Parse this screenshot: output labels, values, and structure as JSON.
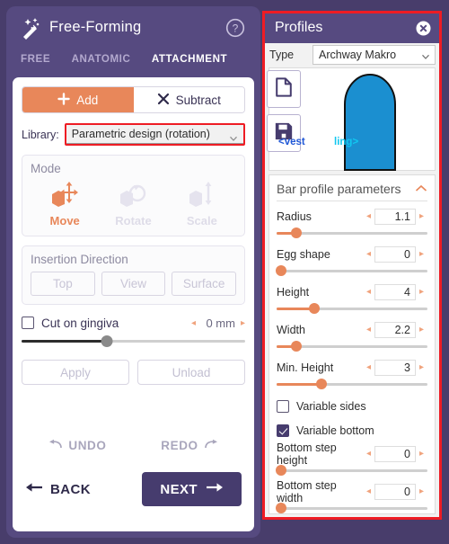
{
  "left_panel": {
    "title": "Free-Forming",
    "wand_icon": "magic-wand-icon",
    "help_icon": "help-circle-icon",
    "tabs": [
      {
        "label": "FREE",
        "active": false
      },
      {
        "label": "ANATOMIC",
        "active": false
      },
      {
        "label": "ATTACHMENT",
        "active": true
      }
    ],
    "segmented": {
      "add_label": "Add",
      "add_icon": "plus-icon",
      "subtract_label": "Subtract",
      "subtract_icon": "x-icon",
      "active": "Add",
      "active_color": "#e8875a"
    },
    "library": {
      "label": "Library:",
      "value": "Parametric design (rotation)",
      "caret_icon": "chevron-down-icon",
      "highlight_color": "#ee1c24"
    },
    "mode": {
      "title": "Mode",
      "items": [
        {
          "label": "Move",
          "icon": "move-tool-icon",
          "state": "active"
        },
        {
          "label": "Rotate",
          "icon": "rotate-tool-icon",
          "state": "disabled"
        },
        {
          "label": "Scale",
          "icon": "scale-tool-icon",
          "state": "disabled"
        }
      ]
    },
    "insertion_direction": {
      "title": "Insertion Direction",
      "buttons": [
        "Top",
        "View",
        "Surface"
      ]
    },
    "cut_on_gingiva": {
      "label": "Cut on gingiva",
      "checked": false,
      "value": "0 mm",
      "slider_percent": 38,
      "left_arrow": "◂",
      "right_arrow": "▸"
    },
    "actions": {
      "apply_label": "Apply",
      "unload_label": "Unload"
    },
    "history": {
      "undo_label": "UNDO",
      "redo_label": "REDO",
      "undo_icon": "undo-arrow-icon",
      "redo_icon": "redo-arrow-icon"
    },
    "nav": {
      "back_label": "BACK",
      "next_label": "NEXT",
      "back_icon": "arrow-left-icon",
      "next_icon": "arrow-right-icon",
      "next_color": "#463c6e"
    }
  },
  "right_panel": {
    "title": "Profiles",
    "close_icon": "close-circle-icon",
    "highlight_color": "#ee1c24",
    "type": {
      "label": "Type",
      "value": "Archway Makro",
      "caret_icon": "chevron-down-icon"
    },
    "tool_buttons": [
      {
        "icon": "new-document-icon",
        "name": "new-profile-button"
      },
      {
        "icon": "floppy-save-icon",
        "name": "save-profile-button"
      }
    ],
    "preview": {
      "shape_color": "#1b8fd0",
      "shape_stroke": "#111111",
      "label_left": "<vest",
      "label_left_color": "#1f57d6",
      "label_right": "ling>",
      "label_right_color": "#11c7f0"
    },
    "params": {
      "title": "Bar profile parameters",
      "collapse_icon": "chevron-up-icon",
      "left_arrow": "◂",
      "right_arrow": "▸",
      "items": [
        {
          "label": "Radius",
          "value": "1.1",
          "percent": 13
        },
        {
          "label": "Egg shape",
          "value": "0",
          "percent": 3
        },
        {
          "label": "Height",
          "value": "4",
          "percent": 25
        },
        {
          "label": "Width",
          "value": "2.2",
          "percent": 13
        },
        {
          "label": "Min. Height",
          "value": "3",
          "percent": 30
        }
      ],
      "checkboxes": [
        {
          "label": "Variable sides",
          "checked": false
        },
        {
          "label": "Variable bottom",
          "checked": true
        }
      ],
      "bottom_items": [
        {
          "label": "Bottom step height",
          "value": "0",
          "percent": 3
        },
        {
          "label": "Bottom step width",
          "value": "0",
          "percent": 3
        }
      ]
    }
  }
}
